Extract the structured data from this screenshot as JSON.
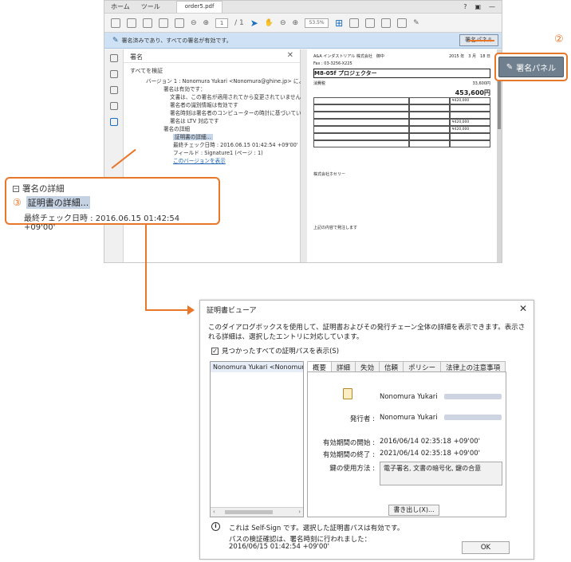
{
  "acrobat": {
    "menu": [
      "ホーム",
      "ツール"
    ],
    "doc_tab": "order5.pdf",
    "page_current": "1",
    "page_total": "/ 1",
    "zoom": "53.5%",
    "sig_bar_text": "署名済みであり、すべての署名が有効です。",
    "sig_panel_button": "署名パネル"
  },
  "panel": {
    "title": "署名",
    "verify_all": "すべてを検証",
    "tree": [
      "バージョン 1 : Nonomura Yukari <Nonomura@ghine.jp> により署名済み",
      "署名は有効です：",
      "文書は、この署名が適用されてから変更されていません",
      "署名者の識別情報は有効です",
      "署名時刻は署名者のコンピューターの時計に基づいています。",
      "署名は LTV 対応です",
      "署名の詳細",
      "証明書の詳細...",
      "最終チェック日時 : 2016.06.15 01:42:54 +09'00'",
      "フィールド : Signature1 (ページ : 1)",
      "このバージョンを表示"
    ]
  },
  "doc": {
    "company": "A&A インダストリアル 株式会社　御中",
    "fax": "Fax : 03-3256-X225",
    "date": "2015 年　3 月　18 日",
    "project": "M8-05f プロジェクター",
    "total_label": "消費税",
    "total": "453,600円",
    "subtotal": "33,600円",
    "line1": "¥420,000",
    "line2": "¥420,000",
    "line3": "¥420,000",
    "seller": "株式会社ホセリー",
    "footer": "上記の内容で発注します"
  },
  "callouts": {
    "num2": "②",
    "num3": "③",
    "c3_line1": "署名の詳細",
    "c3_line2": "証明書の詳細...",
    "c3_line3": "最終チェック日時 : 2016.06.15 01:42:54 +09'00'"
  },
  "dialog": {
    "title": "証明書ビューア",
    "desc": "このダイアログボックスを使用して、証明書およびその発行チェーン全体の詳細を表示できます。表示される詳細は、選択したエントリに対応しています。",
    "checkbox": "見つかったすべての証明パスを表示(S)",
    "list_item": "Nonomura Yukari <Nonomura",
    "tabs": [
      "概要",
      "詳細",
      "失効",
      "信頼",
      "ポリシー",
      "法律上の注意事項"
    ],
    "subject": "Nonomura Yukari",
    "issuer_label": "発行者 :",
    "issuer": "Nonomura Yukari",
    "valid_from_label": "有効期間の開始 :",
    "valid_from": "2016/06/14 02:35:18 +09'00'",
    "valid_to_label": "有効期間の終了 :",
    "valid_to": "2021/06/14 02:35:18 +09'00'",
    "key_usage_label": "鍵の使用方法 :",
    "key_usage": "電子署名, 文書の暗号化, 鍵の合意",
    "export": "書き出し(X)...",
    "info1": "これは Self-Sign です。選択した証明書パスは有効です。",
    "info2": "パスの検証確認は、署名時刻に行われました：",
    "info3": "2016/06/15 01:42:54 +09'00'",
    "ok": "OK"
  }
}
